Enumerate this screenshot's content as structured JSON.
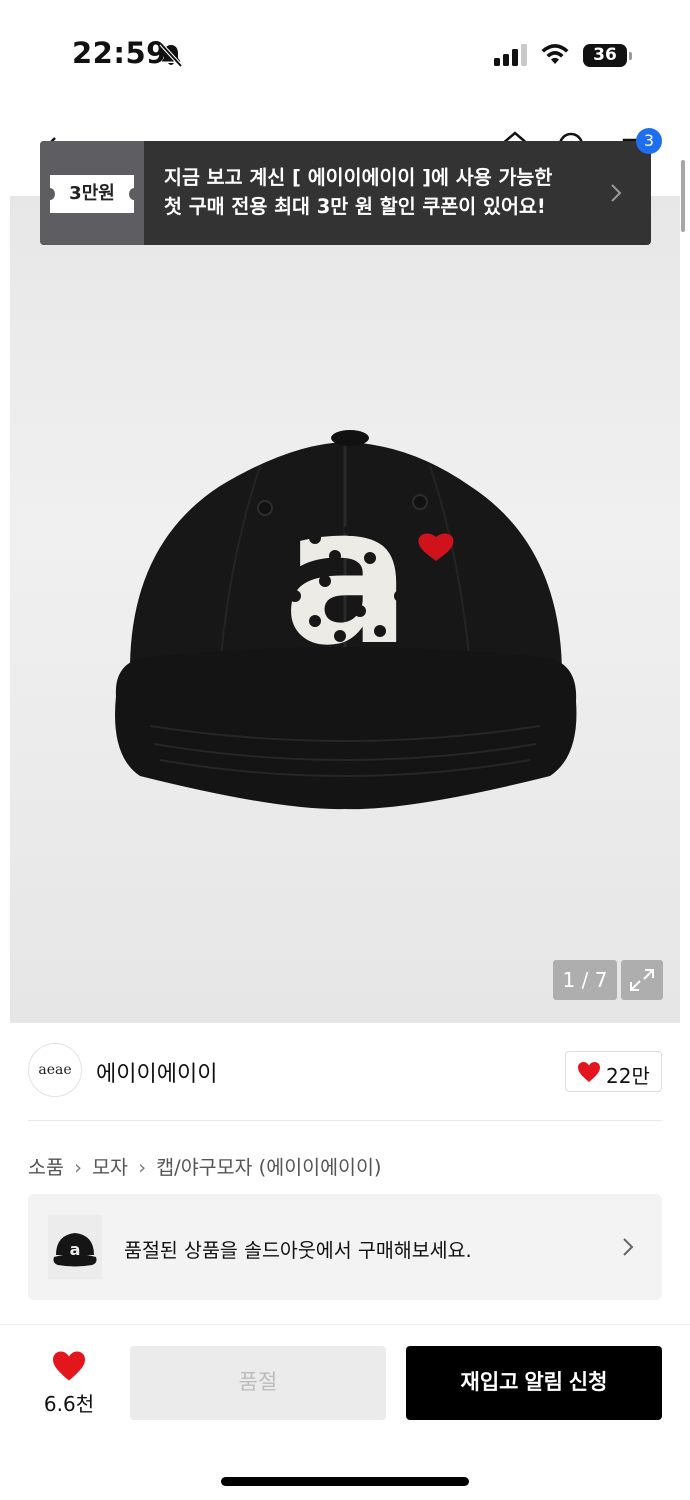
{
  "status_bar": {
    "time": "22:59",
    "battery": "36"
  },
  "header": {
    "cart_count": "3"
  },
  "coupon_banner": {
    "ticket": "3만원",
    "line1": "지금 보고 계신 [ 에이이에이이 ]에 사용 가능한",
    "line2": "첫 구매 전용 최대 3만 원 할인 쿠폰이 있어요!"
  },
  "gallery": {
    "counter": "1 / 7",
    "logo_glyph": "a"
  },
  "brand": {
    "logo_text": "aeae",
    "name": "에이이에이이",
    "like_count": "22만"
  },
  "breadcrumb": [
    "소품",
    "모자",
    "캡/야구모자 (에이이에이이)"
  ],
  "soldout_notice": {
    "text": "품절된 상품을 솔드아웃에서 구매해보세요."
  },
  "bottom_bar": {
    "wish_count": "6.6천",
    "soldout_label": "품절",
    "restock_label": "재입고 알림 신청"
  },
  "colors": {
    "accent_red": "#e4161d",
    "cart_badge": "#1e6ef0",
    "banner_bg": "#333333"
  }
}
